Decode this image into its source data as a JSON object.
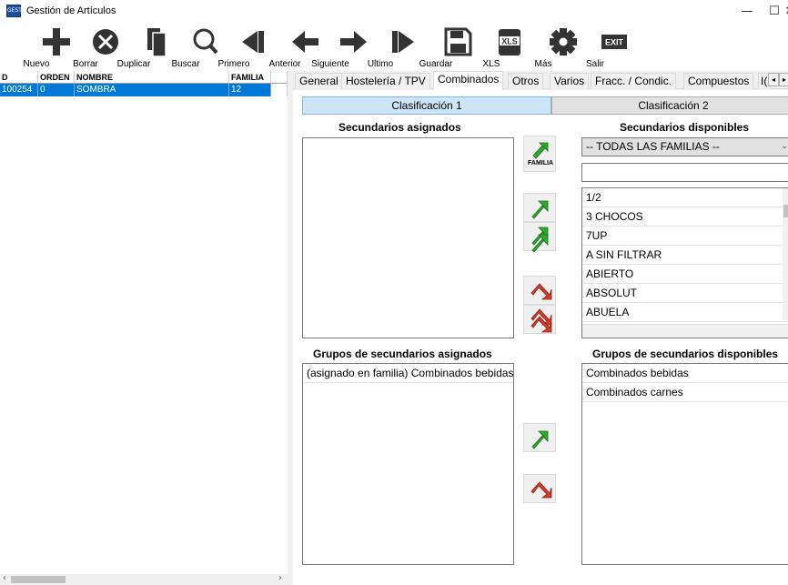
{
  "window": {
    "title": "Gestión de Artículos",
    "icon_text": "GEST",
    "minimize_glyph": "—",
    "maximize_glyph": "☐",
    "close_glyph": "✕"
  },
  "toolbar": {
    "nuevo": "Nuevo",
    "borrar": "Borrar",
    "duplicar": "Duplicar",
    "buscar": "Buscar",
    "primero": "Primero",
    "anterior": "Anterior",
    "siguiente": "Siguiente",
    "ultimo": "Ultimo",
    "guardar": "Guardar",
    "xls": "XLS",
    "mas": "Más",
    "salir": "Salir",
    "xls_icon_text": "XLS",
    "exit_icon_text": "EXIT"
  },
  "grid": {
    "columns": [
      "D",
      "ORDEN",
      "NOMBRE",
      "FAMILIA"
    ],
    "rows": [
      {
        "id": "100254",
        "orden": "0",
        "nombre": "SOMBRA",
        "familia": "12"
      }
    ],
    "scroll_left": "‹",
    "scroll_right": "›"
  },
  "tabs": {
    "items": [
      "General",
      "Hostelería / TPV",
      "Combinados",
      "Otros",
      "Varios",
      "Fracc. / Condic.",
      "Compuestos",
      "I("
    ],
    "active": "Combinados",
    "scroll_left": "◂",
    "scroll_right": "▸"
  },
  "combinados": {
    "clasificacion1": "Clasificación 1",
    "clasificacion2": "Clasificación 2",
    "secundarios_asignados_title": "Secundarios asignados",
    "secundarios_disponibles_title": "Secundarios disponibles",
    "familia_combo": "-- TODAS LAS FAMILIAS --",
    "familia_button_label": "FAMILIA",
    "filter_value": "",
    "secundarios_disponibles": [
      "1/2",
      "3 CHOCOS",
      "7UP",
      "A  SIN FILTRAR",
      "ABIERTO",
      "ABSOLUT",
      "ABUELA"
    ],
    "grupos_asignados_title": "Grupos de secundarios asignados",
    "grupos_disponibles_title": "Grupos de secundarios disponibles",
    "grupos_asignados": [
      "(asignado en familia) Combinados bebidas"
    ],
    "grupos_disponibles": [
      "Combinados bebidas",
      "Combinados carnes"
    ]
  },
  "colors": {
    "selection": "#0078d7",
    "green_arrow": "#2ea82e",
    "red_arrow": "#d43a2a",
    "active_class": "#cde5f7"
  }
}
